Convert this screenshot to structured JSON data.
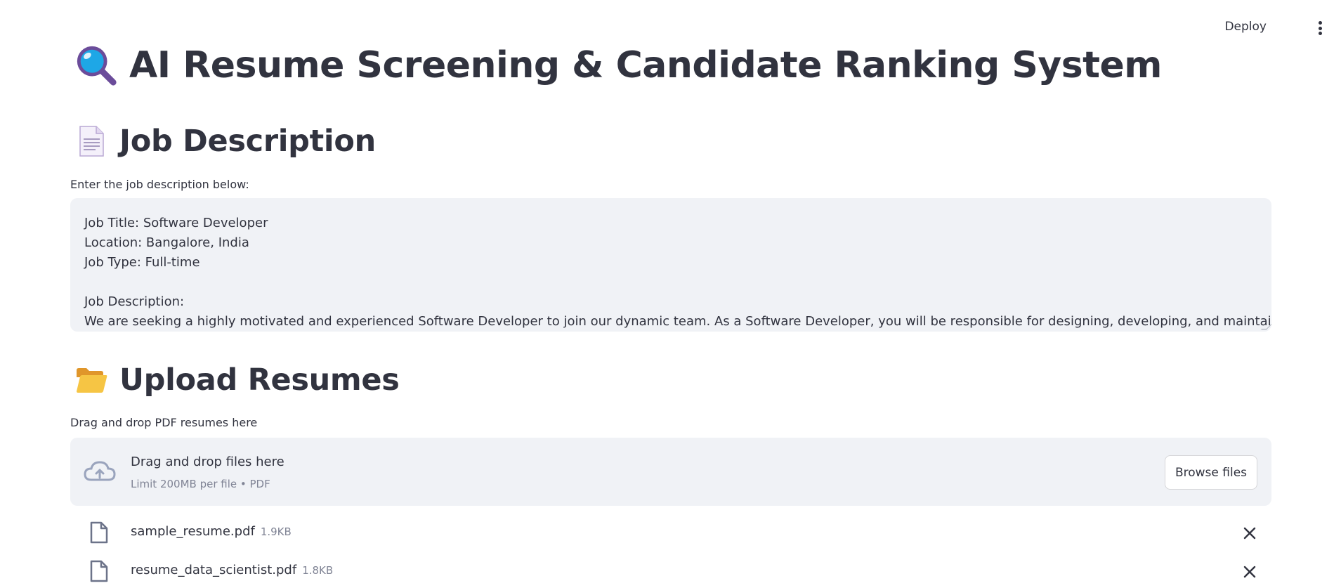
{
  "header": {
    "deploy_label": "Deploy",
    "menu_icon": "kebab-menu-icon"
  },
  "page": {
    "title_icon": "magnifying-glass-icon",
    "title": "AI Resume Screening & Candidate Ranking System"
  },
  "job_section": {
    "icon": "page-document-icon",
    "heading": "Job Description",
    "input_label": "Enter the job description below:",
    "textarea_lines": [
      "Job Title: Software Developer",
      "Location: Bangalore, India",
      "Job Type: Full-time",
      "",
      "Job Description:",
      "We are seeking a highly motivated and experienced Software Developer to join our dynamic team. As a Software Developer, you will be responsible for designing, developing, and maintaining high-"
    ]
  },
  "upload_section": {
    "icon": "open-folder-icon",
    "heading": "Upload Resumes",
    "input_label": "Drag and drop PDF resumes here",
    "dropzone": {
      "icon": "cloud-upload-icon",
      "title": "Drag and drop files here",
      "subtitle": "Limit 200MB per file • PDF",
      "browse_label": "Browse files"
    },
    "files": [
      {
        "name": "sample_resume.pdf",
        "size": "1.9KB",
        "icon": "file-icon",
        "remove_icon": "close-icon"
      },
      {
        "name": "resume_data_scientist.pdf",
        "size": "1.8KB",
        "icon": "file-icon",
        "remove_icon": "close-icon"
      }
    ]
  },
  "colors": {
    "text": "#31333f",
    "muted": "#808495",
    "input_bg": "#f0f2f6",
    "icon_blue": "#1ea7e6",
    "icon_purple": "#6b4c9a",
    "folder_yellow": "#f6b93b"
  }
}
